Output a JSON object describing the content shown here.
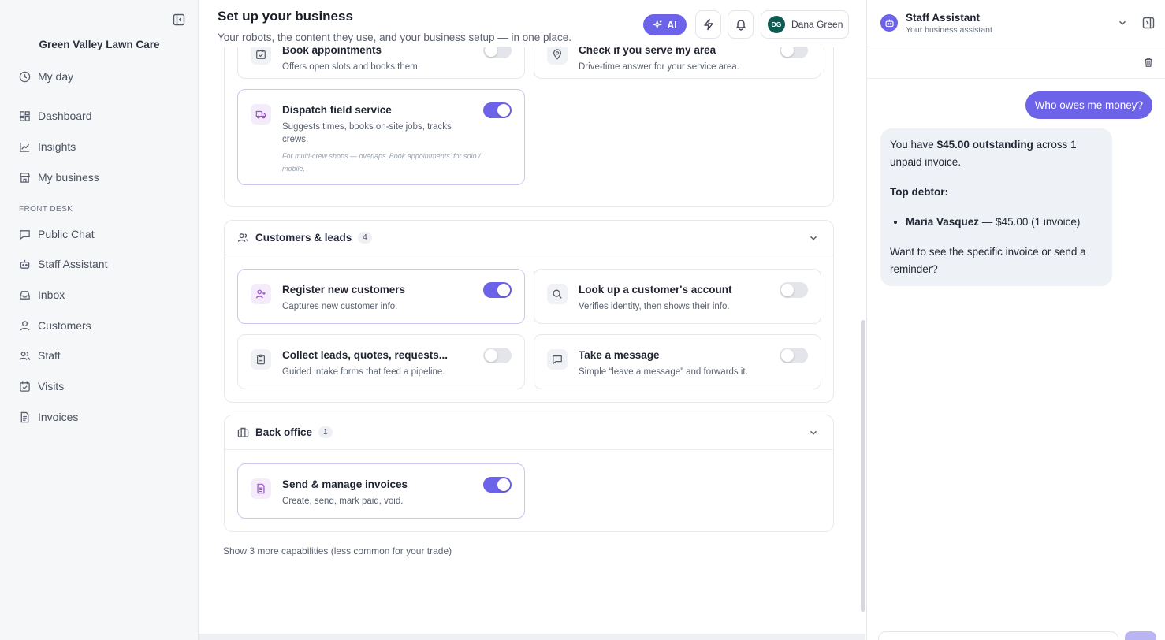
{
  "sidebar": {
    "business_name": "Green Valley Lawn Care",
    "section_front_desk": "FRONT DESK",
    "items": [
      {
        "label": "My day",
        "icon": "clock-icon"
      },
      {
        "label": "Dashboard",
        "icon": "dashboard-icon"
      },
      {
        "label": "Insights",
        "icon": "chart-icon"
      },
      {
        "label": "My business",
        "icon": "store-icon"
      },
      {
        "label": "Public Chat",
        "icon": "chat-icon"
      },
      {
        "label": "Staff Assistant",
        "icon": "bot-icon"
      },
      {
        "label": "Inbox",
        "icon": "inbox-icon"
      },
      {
        "label": "Customers",
        "icon": "user-icon"
      },
      {
        "label": "Staff",
        "icon": "users-icon"
      },
      {
        "label": "Visits",
        "icon": "calendar-check-icon"
      },
      {
        "label": "Invoices",
        "icon": "file-icon"
      }
    ]
  },
  "header": {
    "title": "Set up your business",
    "subtitle": "Your robots, the content they use, and your business setup — in one place.",
    "ai_label": "AI",
    "user_initials": "DG",
    "user_name": "Dana Green"
  },
  "groups": {
    "first": {
      "cards": [
        {
          "title": "Book appointments",
          "desc": "Offers open slots and books them.",
          "on": false
        },
        {
          "title": "Check if you serve my area",
          "desc": "Drive-time answer for your service area.",
          "on": false
        },
        {
          "title": "Dispatch field service",
          "desc": "Suggests times, books on-site jobs, tracks crews.",
          "note": "For multi-crew shops — overlaps 'Book appointments' for solo / mobile.",
          "on": true
        }
      ]
    },
    "customers": {
      "title": "Customers & leads",
      "count": "4",
      "cards": [
        {
          "title": "Register new customers",
          "desc": "Captures new customer info.",
          "on": true
        },
        {
          "title": "Look up a customer's account",
          "desc": "Verifies identity, then shows their info.",
          "on": false
        },
        {
          "title": "Collect leads, quotes, requests...",
          "desc": "Guided intake forms that feed a pipeline.",
          "on": false
        },
        {
          "title": "Take a message",
          "desc": "Simple “leave a message” and forwards it.",
          "on": false
        }
      ]
    },
    "back_office": {
      "title": "Back office",
      "count": "1",
      "cards": [
        {
          "title": "Send & manage invoices",
          "desc": "Create, send, mark paid, void.",
          "on": true
        }
      ]
    },
    "more_link": "Show 3 more capabilities (less common for your trade)"
  },
  "chat": {
    "title": "Staff Assistant",
    "subtitle": "Your business assistant",
    "user_message": "Who owes me money?",
    "bot": {
      "line1_pre": "You have ",
      "line1_bold": "$45.00 outstanding",
      "line1_post": " across 1 unpaid invoice.",
      "top_debtor": "Top debtor:",
      "debtor_name": "Maria Vasquez",
      "debtor_detail": " — $45.00 (1 invoice)",
      "closing": "Want to see the specific invoice or send a reminder?"
    }
  },
  "colors": {
    "accent": "#6c63e8",
    "card_on_border": "#cfc4f2",
    "sidebar_bg": "#f6f7f9"
  }
}
